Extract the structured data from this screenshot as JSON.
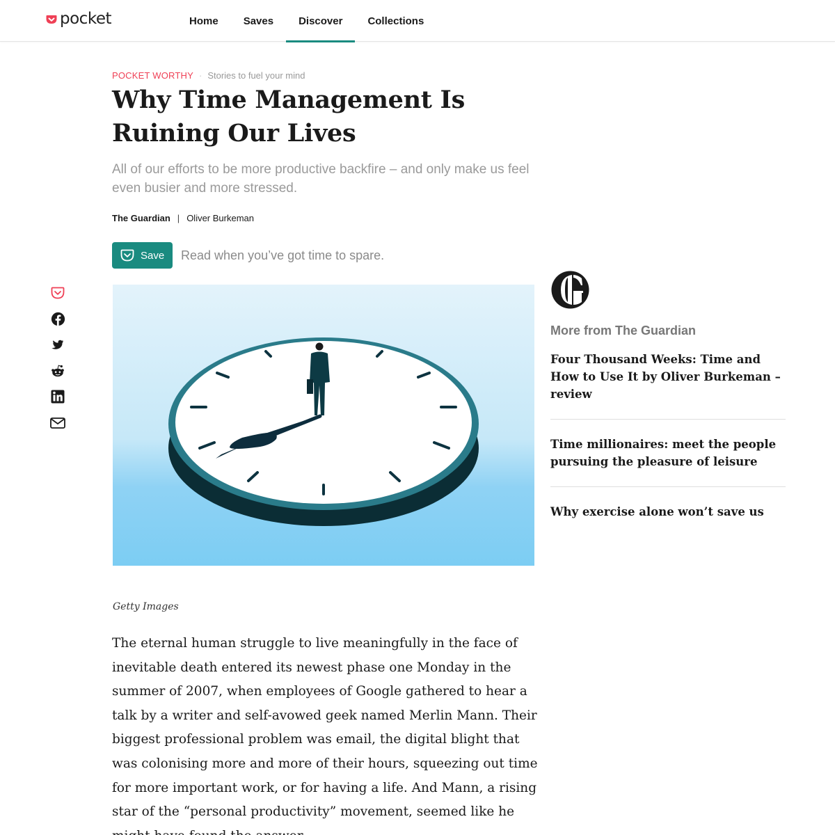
{
  "brand": {
    "name": "pocket",
    "accent": "#ef4056",
    "teal": "#1a8b80"
  },
  "nav": {
    "items": [
      {
        "label": "Home",
        "active": false
      },
      {
        "label": "Saves",
        "active": false
      },
      {
        "label": "Discover",
        "active": true
      },
      {
        "label": "Collections",
        "active": false
      }
    ]
  },
  "article": {
    "kicker": "POCKET WORTHY",
    "kicker_sep": "·",
    "kicker_sub": "Stories to fuel your mind",
    "title": "Why Time Management Is Ruining Our Lives",
    "excerpt": "All of our efforts to be more productive backfire – and only make us feel even busier and more stressed.",
    "publisher": "The Guardian",
    "byline_sep": "|",
    "author": "Oliver Burkeman",
    "save_label": "Save",
    "save_note": "Read when you’ve got time to spare.",
    "image_caption": "Getty Images",
    "body": "The eternal human struggle to live meaningfully in the face of inevitable death entered its newest phase one Monday in the summer of 2007, when employees of Google gathered to hear a talk by a writer and self-avowed geek named Merlin Mann. Their biggest professional problem was email, the digital blight that was colonising more and more of their hours, squeezing out time for more important work, or for having a life. And Mann, a rising star of the “personal productivity” movement, seemed like he might have found the answer."
  },
  "share": {
    "icons": [
      "pocket-icon",
      "facebook-icon",
      "twitter-icon",
      "reddit-icon",
      "linkedin-icon",
      "email-icon"
    ]
  },
  "rail": {
    "heading": "More from The Guardian",
    "items": [
      "Four Thousand Weeks: Time and How to Use It by Oliver Burkeman – review",
      "Time millionaires: meet the people pursuing the pleasure of leisure",
      "Why exercise alone won’t save us"
    ]
  }
}
